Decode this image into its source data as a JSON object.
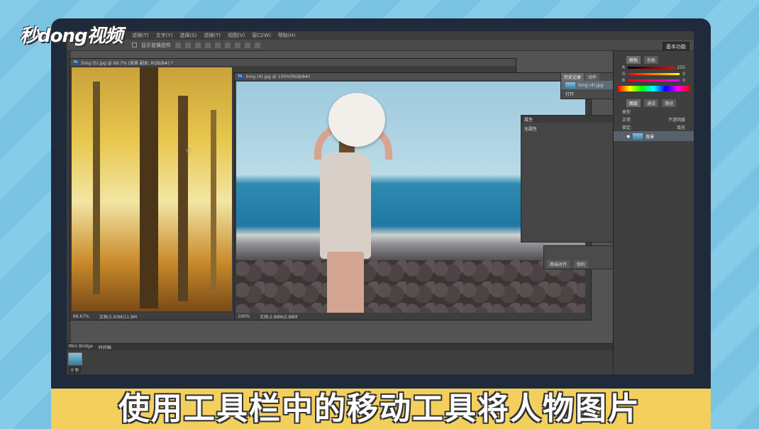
{
  "logo": {
    "text": "秒dong视频"
  },
  "menubar": {
    "items": [
      "滤镜(T)",
      "文字(Y)",
      "选择(S)",
      "滤镜(T)",
      "视图(V)",
      "窗口(W)",
      "帮助(H)"
    ]
  },
  "options_bar": {
    "show_transform_controls": "显示变换控件"
  },
  "workspace_button": "基本功能",
  "doc1": {
    "title": "timg (5).jpg @ 66.7% (背景 副本, RGB/8#) *",
    "zoom": "66.67%",
    "doc_info": "文档:5.93M/11.9M"
  },
  "doc2": {
    "title": "timg (4).jpg @ 100%(RGB/8#)",
    "zoom": "100%",
    "doc_info": "文档:2.88M/2.88M"
  },
  "history_panel": {
    "tabs": [
      "历史记录",
      "动作"
    ],
    "items": [
      {
        "label": "timg (4).jpg"
      },
      {
        "label": "打开"
      }
    ]
  },
  "properties_panel": {
    "title": "属性",
    "body": "无属性"
  },
  "char_panel": {
    "font": "两端对齐",
    "style": "锐利"
  },
  "color_panel": {
    "tabs": [
      "颜色",
      "色板"
    ],
    "r": "255",
    "g": "0",
    "b": "0"
  },
  "layers_panel": {
    "tabs": [
      "图层",
      "通道",
      "路径"
    ],
    "kind": "类型",
    "mode": "正常",
    "opacity_label": "不透明度",
    "lock_label": "锁定:",
    "fill_label": "填充",
    "layer_name": "背景"
  },
  "mini_bridge": {
    "tabs": [
      "Mini Bridge",
      "时间轴"
    ],
    "frame_time": "0 秒"
  },
  "subtitle": "使用工具栏中的移动工具将人物图片"
}
